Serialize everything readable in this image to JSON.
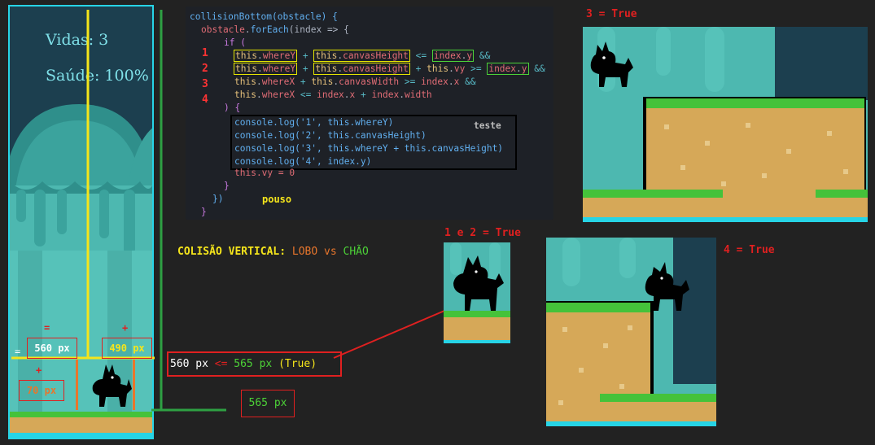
{
  "hud": {
    "lives": "Vidas: 3",
    "health": "Saúde: 100%"
  },
  "game_labels": {
    "eq_sign": "=",
    "plus_sign1": "+",
    "plus_sign2": "+",
    "eq_prefix": "=",
    "whereY_value": "560 px",
    "canvasHeight_value": "490 px",
    "vy_value": "70 px"
  },
  "code": {
    "line1": "collisionBottom(obstacle) {",
    "foreach_obj": "obstacle",
    "foreach_method": "forEach",
    "foreach_arg": "(index => {",
    "if": "if (",
    "this": "this",
    "whereY": "whereY",
    "whereX": "whereX",
    "canvasHeight": "canvasHeight",
    "canvasWidth": "canvasWidth",
    "vy": "vy",
    "index": "index",
    "y": "y",
    "x": "x",
    "width": "width",
    "lte": "<=",
    "gte": ">=",
    "plus": "+",
    "and": "&&",
    "close_paren": ") {",
    "log1": "console.log('1', this.whereY)",
    "log2": "console.log('2', this.canvasHeight)",
    "log3": "console.log('3', this.whereY + this.canvasHeight)",
    "log4": "console.log('4', index.y)",
    "vy_zero": "this.vy = 0",
    "close_brace1": "}",
    "close_brace2": "})",
    "close_brace3": "}",
    "teste": "teste",
    "pouso": "pouso"
  },
  "condition_numbers": [
    "1",
    "2",
    "3",
    "4"
  ],
  "title": {
    "prefix": "COLISÃO VERTICAL:",
    "lobo": "LOBO",
    "vs": "vs",
    "chao": "CHÃO"
  },
  "comparison": {
    "left": "560 px",
    "op": "<=",
    "right": "565 px",
    "result": "(True)"
  },
  "ground_value": "565 px",
  "captions": {
    "three": "3 = True",
    "one_two": "1 e 2 = True",
    "four": "4 = True"
  },
  "colors": {
    "yellow": "#f5e51b",
    "green": "#2ea043",
    "red": "#e02020",
    "cyan": "#27d4e6",
    "orange": "#e8762c"
  }
}
